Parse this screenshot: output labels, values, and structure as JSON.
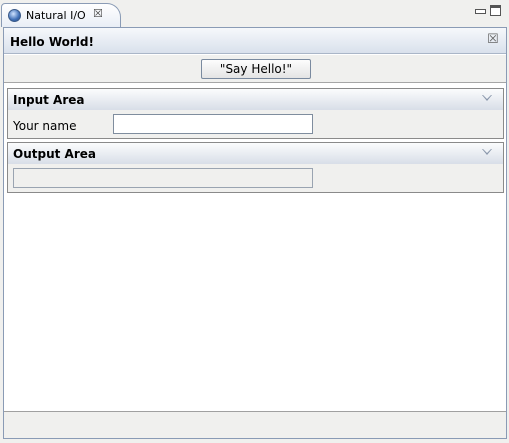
{
  "tab": {
    "title": "Natural I/O",
    "close_glyph": "☒",
    "icon": "globe-icon"
  },
  "window_controls": {
    "minimize_icon": "minimize-icon",
    "maximize_icon": "maximize-icon"
  },
  "form": {
    "title": "Hello World!",
    "close_glyph": "☒"
  },
  "toolbar": {
    "say_hello_label": "\"Say Hello!\""
  },
  "input_area": {
    "title": "Input Area",
    "name_label": "Your name",
    "name_value": "",
    "toggle_icon": "chevron-down-icon"
  },
  "output_area": {
    "title": "Output Area",
    "output_value": "",
    "toggle_icon": "chevron-down-icon"
  }
}
